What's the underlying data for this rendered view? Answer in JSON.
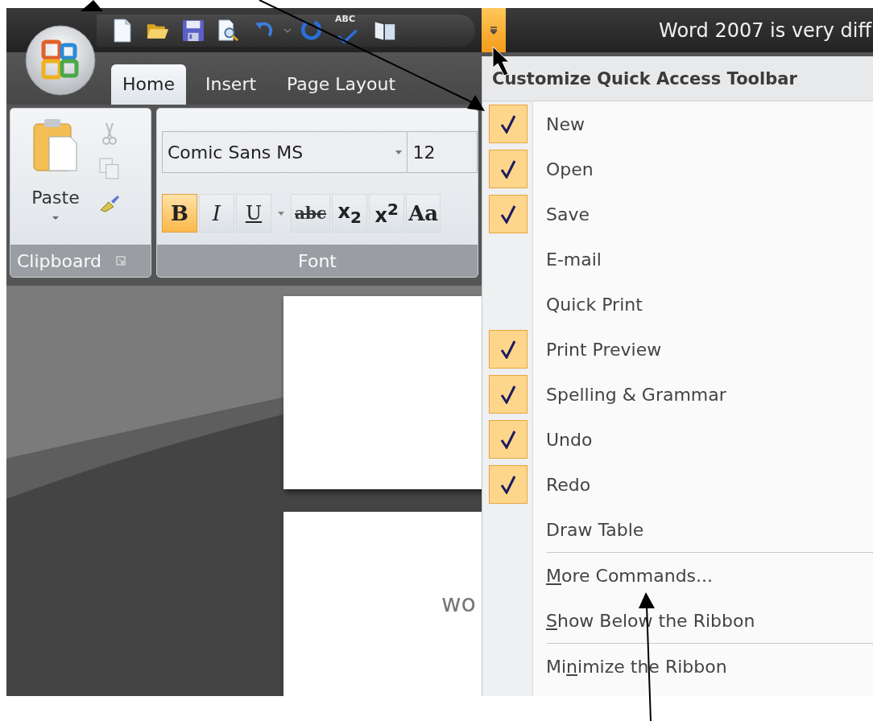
{
  "window": {
    "title": "Word 2007 is very diff"
  },
  "quick_access_toolbar": {
    "menu_button_active": true,
    "items": [
      {
        "kind": "new"
      },
      {
        "kind": "open"
      },
      {
        "kind": "save"
      },
      {
        "kind": "print-preview"
      },
      {
        "kind": "undo"
      },
      {
        "kind": "dropdown"
      },
      {
        "kind": "redo"
      },
      {
        "kind": "spelling",
        "text": "ABC"
      },
      {
        "kind": "reading"
      }
    ]
  },
  "tabs": [
    {
      "label": "Home",
      "selected": true
    },
    {
      "label": "Insert",
      "selected": false
    },
    {
      "label": "Page Layout",
      "selected": false
    }
  ],
  "ribbon": {
    "clipboard": {
      "paste_label": "Paste",
      "group_label": "Clipboard"
    },
    "font": {
      "font_name": "Comic Sans MS",
      "font_size": "12",
      "group_label": "Font",
      "buttons": [
        {
          "kind": "bold",
          "label": "B",
          "selected": true
        },
        {
          "kind": "italic",
          "label": "I",
          "selected": false
        },
        {
          "kind": "underline",
          "label": "U",
          "selected": false
        },
        {
          "kind": "dropdown"
        },
        {
          "kind": "strike",
          "label": "abc",
          "selected": false
        },
        {
          "kind": "script",
          "label": "x$_{2}$",
          "selected": false
        },
        {
          "kind": "script",
          "label": "x$^{2}$",
          "selected": false
        },
        {
          "kind": "case",
          "label": "Aa",
          "selected": false
        }
      ]
    }
  },
  "document": {
    "page_text": "wo"
  },
  "menu": {
    "title": "Customize Quick Access Toolbar",
    "commands": [
      {
        "label": "New",
        "checked": true
      },
      {
        "label": "Open",
        "checked": true
      },
      {
        "label": "Save",
        "checked": true
      },
      {
        "label": "E-mail",
        "checked": false
      },
      {
        "label": "Quick Print",
        "checked": false
      },
      {
        "label": "Print Preview",
        "checked": true
      },
      {
        "label": "Spelling & Grammar",
        "checked": true
      },
      {
        "label": "Undo",
        "checked": true
      },
      {
        "label": "Redo",
        "checked": true
      },
      {
        "label": "Draw Table",
        "checked": false
      }
    ],
    "action_groups": [
      [
        {
          "key": "M",
          "after": "ore Commands..."
        },
        {
          "key": "S",
          "after": "how Below the Ribbon"
        }
      ],
      [
        {
          "before": "Mi",
          "key": "n",
          "after": "imize the Ribbon"
        }
      ]
    ]
  }
}
